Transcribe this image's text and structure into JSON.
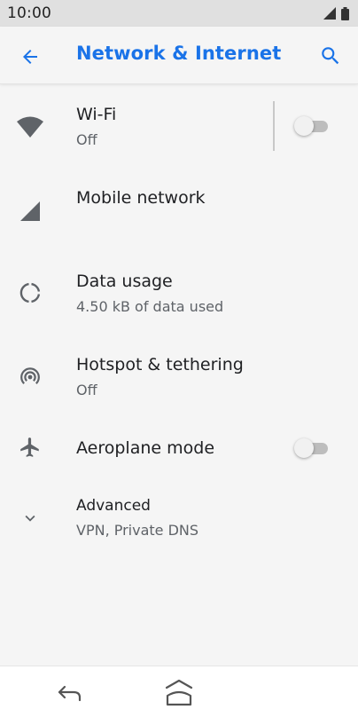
{
  "status_bar": {
    "time": "10:00"
  },
  "app_bar": {
    "title": "Network & Internet"
  },
  "items": [
    {
      "title": "Wi-Fi",
      "subtitle": "Off",
      "icon": "wifi-icon",
      "toggle": false
    },
    {
      "title": "Mobile network",
      "icon": "signal-icon"
    },
    {
      "title": "Data usage",
      "subtitle": "4.50 kB of data used",
      "icon": "data-usage-icon"
    },
    {
      "title": "Hotspot & tethering",
      "subtitle": "Off",
      "icon": "hotspot-icon"
    },
    {
      "title": "Aeroplane mode",
      "icon": "airplane-icon",
      "toggle": false
    },
    {
      "title": "Advanced",
      "subtitle": "VPN, Private DNS",
      "icon": "chevron-down-icon"
    }
  ],
  "colors": {
    "accent": "#1a73e8",
    "icon": "#5f6368",
    "background": "#f5f5f5"
  }
}
